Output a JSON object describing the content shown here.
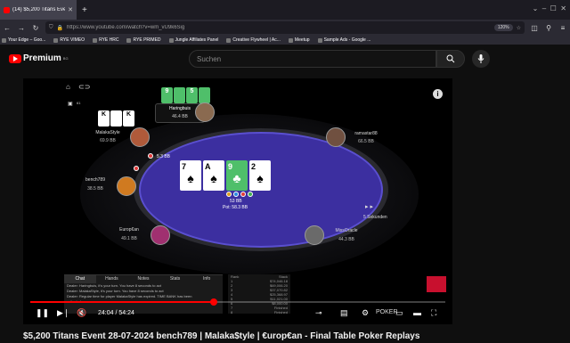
{
  "browser": {
    "tab_title": "(14) $5,200 Titans Event 28-07-",
    "url": "https://www.youtube.com/watch?v=wm_vU9k6Sig",
    "zoom": "120%",
    "bookmarks": [
      "Your Edge – Goo...",
      "RYE VIMEO",
      "RYE HRC",
      "RYE PRIMED",
      "Jungle Affiliates Panel",
      "Creative Flywheel | Ac...",
      "Meetup",
      "Sample Ads - Google ..."
    ]
  },
  "youtube": {
    "brand": "Premium",
    "region": "BG",
    "search_placeholder": "Suchen"
  },
  "table": {
    "pot_label": "Pot: 58.3 BB",
    "board": [
      {
        "rank": "7",
        "suit": "♠",
        "style": "white"
      },
      {
        "rank": "A",
        "suit": "♠",
        "style": "white"
      },
      {
        "rank": "9",
        "suit": "♣",
        "style": "green"
      },
      {
        "rank": "2",
        "suit": "♠",
        "style": "white"
      }
    ],
    "center_bet": "53 BB",
    "seats": [
      {
        "name": "Haringbuis",
        "bb": "46.4 BB"
      },
      {
        "name": "MalakaStyle",
        "bb": "69.9 BB"
      },
      {
        "name": "ramastar88",
        "bb": "66.5 BB"
      },
      {
        "name": "bench789",
        "bb": "38.5 BB"
      },
      {
        "name": "Europ€an",
        "bb": "49.1 BB"
      },
      {
        "name": "MissOracle",
        "bb": "44.3 BB"
      }
    ],
    "left_bet": "5.3 BB",
    "hero_cards": [
      "9",
      "5"
    ],
    "malaka_cards": [
      "K",
      "K"
    ],
    "timer": "5 Sekunden",
    "mini_counter": "61"
  },
  "panel": {
    "tabs": [
      "Chat",
      "Hands",
      "Notes",
      "Stats",
      "Info"
    ],
    "chat_lines": [
      "Dealer: Haringbuis, it's your turn. You have 8 seconds to act",
      "Dealer: MalakaStyle, it's your turn. You have 8 seconds to act",
      "Dealer: Regular time for player MalakaStyle has expired. TIME BANK has been",
      "activated"
    ],
    "hist_header": [
      "Rank",
      "Stack"
    ],
    "hist_rows": [
      [
        "1",
        "$74,046.18"
      ],
      [
        "2",
        "$69,006.20"
      ],
      [
        "3",
        "$37,070.82"
      ],
      [
        "4",
        "$25,368.97"
      ],
      [
        "5",
        "$11,021.00"
      ],
      [
        "6",
        "$8,000.00"
      ],
      [
        "7",
        "Finished"
      ],
      [
        "8",
        "Finished"
      ]
    ]
  },
  "player": {
    "time_current": "24:04",
    "time_total": "54:24",
    "progress": 0.443,
    "overlay_text": "POKER"
  },
  "video_title": "$5,200 Titans Event 28-07-2024 bench789 | Malaka$tyle | €urop€an - Final Table Poker Replays"
}
